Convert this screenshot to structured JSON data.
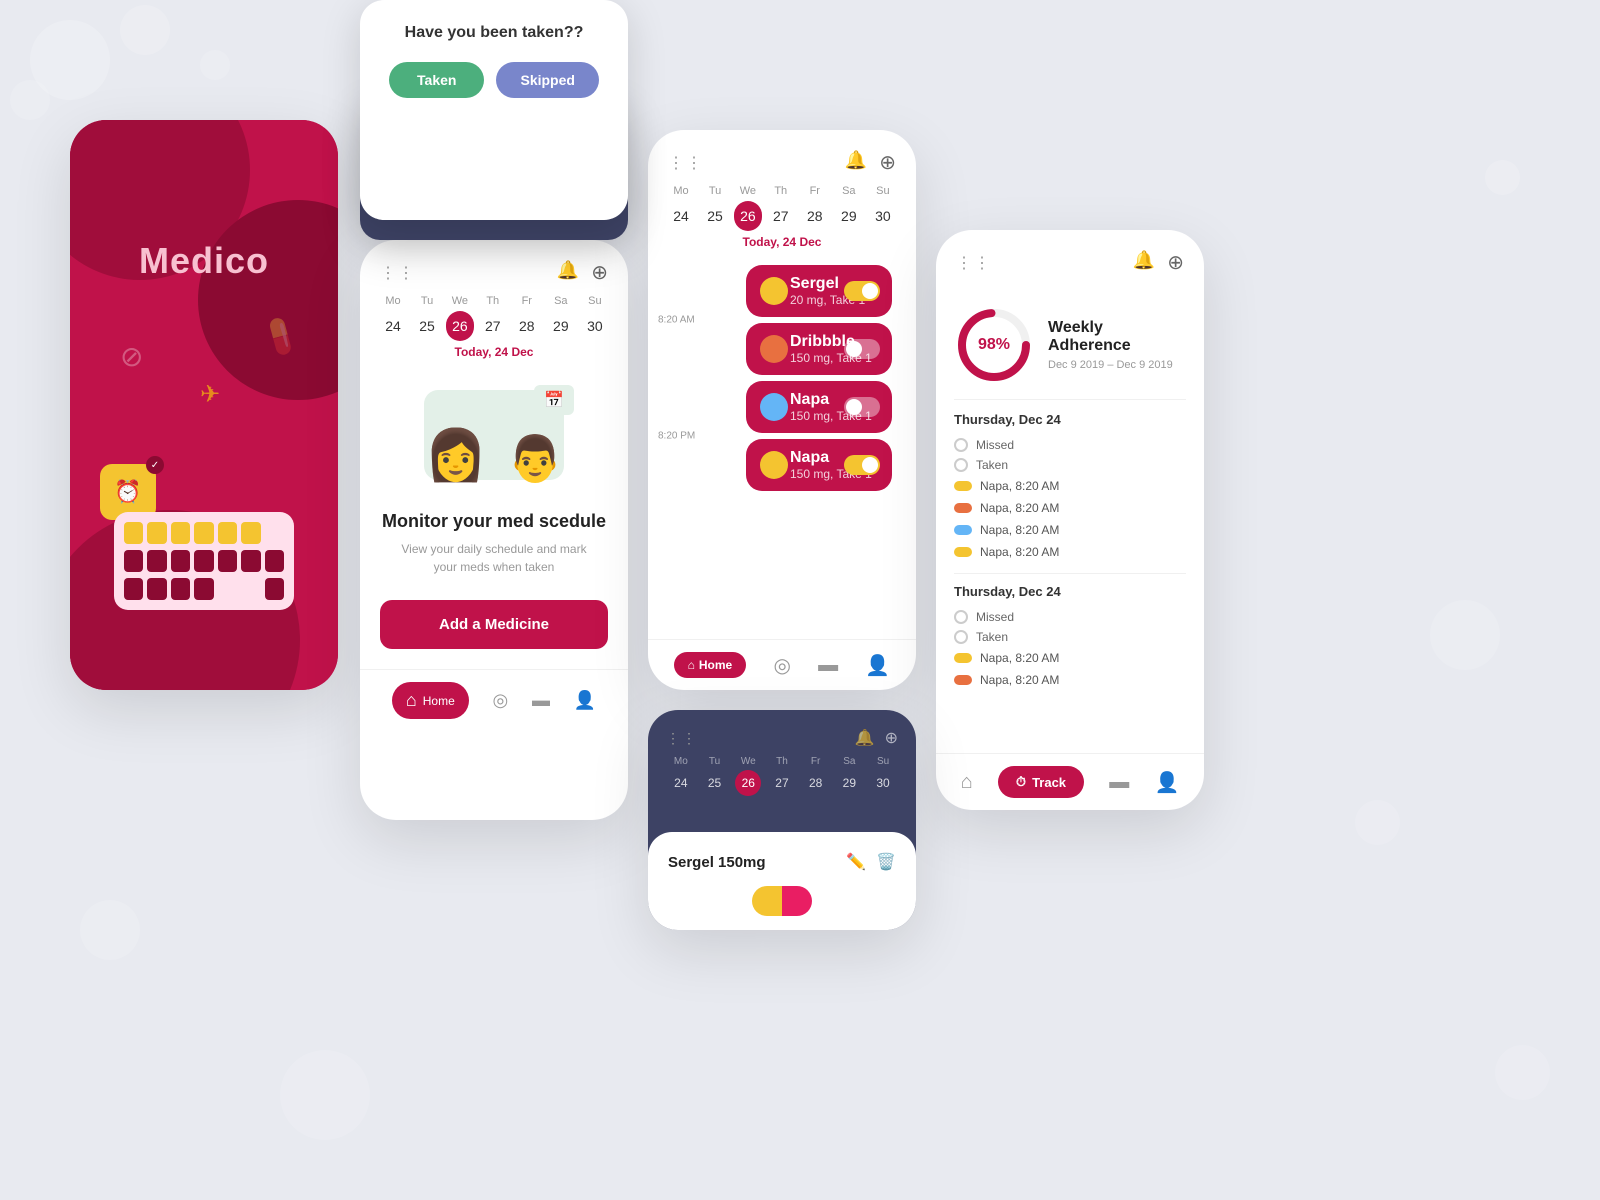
{
  "app": {
    "name": "Medico",
    "bg_color": "#e8eaf0"
  },
  "dialog": {
    "title": "Have you been taken??",
    "taken_label": "Taken",
    "skipped_label": "Skipped"
  },
  "schedule": {
    "week_days": [
      "Mo",
      "Tu",
      "We",
      "Th",
      "Fr",
      "Sa",
      "Su"
    ],
    "week_dates": [
      "24",
      "25",
      "26",
      "27",
      "28",
      "29",
      "30"
    ],
    "active_day": "We",
    "active_date": "26",
    "today_label": "Today, 24 Dec",
    "monitor_title": "Monitor your med scedule",
    "monitor_sub": "View your daily schedule and mark your meds when taken",
    "add_button": "Add a Medicine",
    "nav_home": "Home",
    "nav_chart": "📊",
    "nav_card": "💳",
    "nav_user": "👤"
  },
  "calendar_meds": {
    "today_label": "Today, 24 Dec",
    "time1": "8:20 AM",
    "time2": "8:20 PM",
    "meds": [
      {
        "name": "Sergel",
        "dose": "20 mg, Take 1",
        "color": "#f4c430",
        "toggle": "on"
      },
      {
        "name": "Dribbble",
        "dose": "150 mg, Take 1",
        "color": "#e87040",
        "toggle": "off"
      },
      {
        "name": "Napa",
        "dose": "150 mg, Take 1",
        "color": "#64b5f6",
        "toggle": "off"
      },
      {
        "name": "Napa",
        "dose": "150 mg, Take 1",
        "color": "#f4c430",
        "toggle": "on"
      }
    ]
  },
  "adherence": {
    "percentage": "98%",
    "title": "Weekly Adherence",
    "dates": "Dec 9 2019 – Dec 9 2019",
    "section1": "Thursday, Dec 24",
    "missed_label": "Missed",
    "taken_label": "Taken",
    "meds_section1": [
      {
        "name": "Napa, 8:20 AM",
        "color": "#f4c430"
      },
      {
        "name": "Napa, 8:20 AM",
        "color": "#e87040"
      },
      {
        "name": "Napa, 8:20 AM",
        "color": "#64b5f6"
      },
      {
        "name": "Napa, 8:20 AM",
        "color": "#f4c430"
      }
    ],
    "section2": "Thursday, Dec 24",
    "meds_section2": [
      {
        "name": "Napa, 8:20 AM",
        "color": "#f4c430"
      },
      {
        "name": "Napa, 8:20 AM",
        "color": "#e87040"
      }
    ],
    "track_label": "Track"
  },
  "sergel_detail": {
    "title": "Sergel 150mg",
    "week_days": [
      "Mo",
      "Tu",
      "We",
      "Th",
      "Fr",
      "Sa",
      "Su"
    ],
    "week_dates": [
      "24",
      "25",
      "26",
      "27",
      "28",
      "29",
      "30"
    ],
    "active_day": "We",
    "active_date": "26"
  }
}
